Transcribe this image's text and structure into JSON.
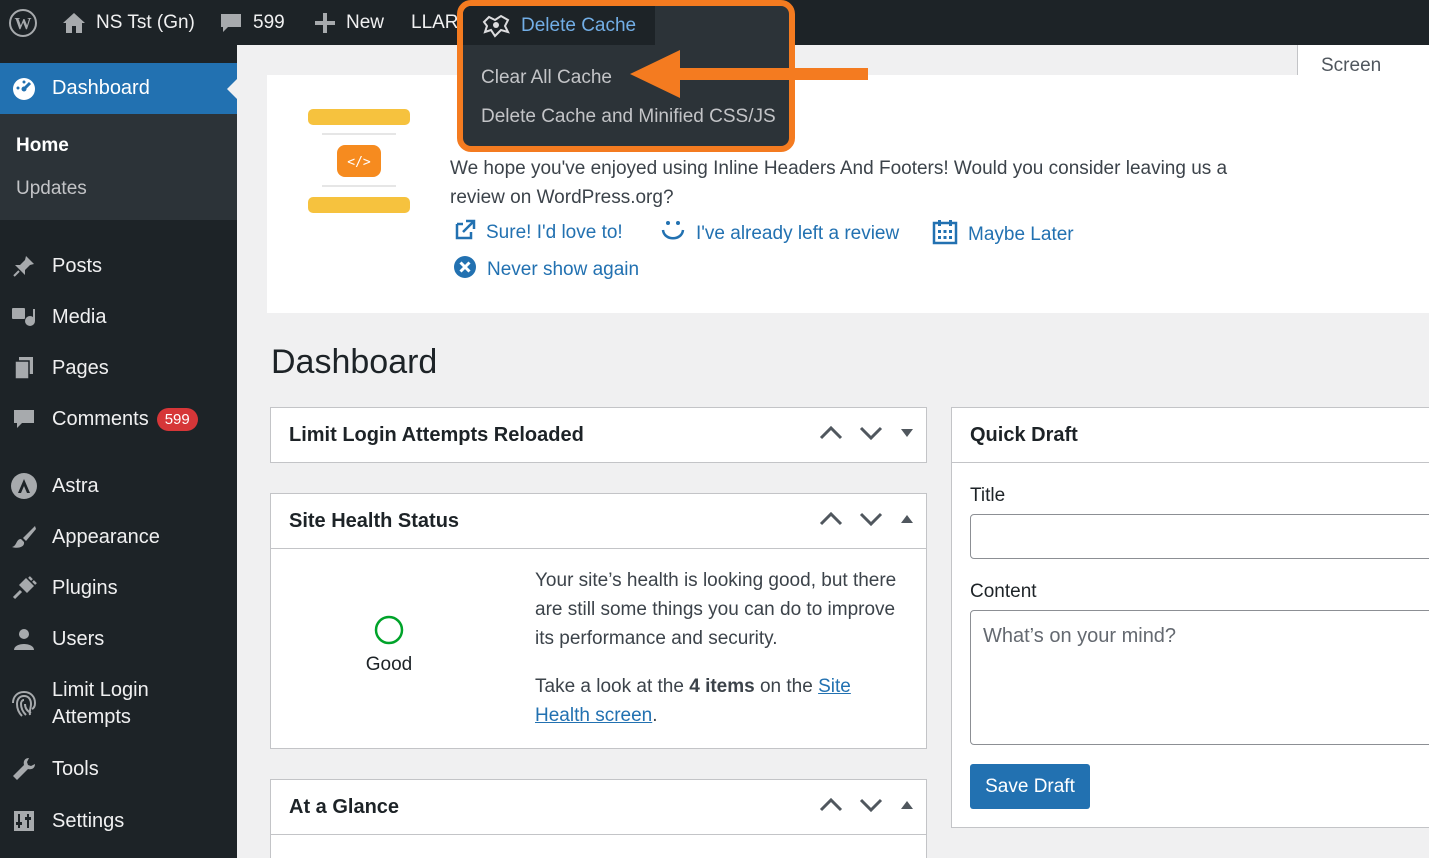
{
  "adminbar": {
    "site_name": "NS Tst (Gn)",
    "comments_count": "599",
    "new_label": "New",
    "llar_label": "LLAR"
  },
  "cache_menu": {
    "title": "Delete Cache",
    "items": [
      "Clear All Cache",
      "Delete Cache and Minified CSS/JS"
    ]
  },
  "screen_options": "Screen Options",
  "sidebar": {
    "dashboard": "Dashboard",
    "submenu": [
      "Home",
      "Updates"
    ],
    "items": [
      {
        "label": "Posts",
        "icon": "pin-icon"
      },
      {
        "label": "Media",
        "icon": "media-icon"
      },
      {
        "label": "Pages",
        "icon": "pages-icon"
      },
      {
        "label": "Comments",
        "icon": "comment-icon",
        "badge": "599"
      },
      {
        "label": "Astra",
        "icon": "astra-icon"
      },
      {
        "label": "Appearance",
        "icon": "brush-icon"
      },
      {
        "label": "Plugins",
        "icon": "plug-icon"
      },
      {
        "label": "Users",
        "icon": "user-icon"
      },
      {
        "label": "Limit Login Attempts",
        "icon": "fingerprint-icon"
      },
      {
        "label": "Tools",
        "icon": "wrench-icon"
      },
      {
        "label": "Settings",
        "icon": "settings-icon"
      }
    ]
  },
  "notice": {
    "text": "We hope you've enjoyed using Inline Headers And Footers! Would you consider leaving us a review on WordPress.org?",
    "links": {
      "sure": "Sure! I'd love to!",
      "already": "I've already left a review",
      "later": "Maybe Later",
      "never": "Never show again"
    }
  },
  "page_title": "Dashboard",
  "widgets": {
    "llar": "Limit Login Attempts Reloaded",
    "health": {
      "title": "Site Health Status",
      "status": "Good",
      "p1": "Your site’s health is looking good, but there are still some things you can do to improve its performance and security.",
      "p2_before": "Take a look at the ",
      "p2_count": "4 items",
      "p2_middle": " on the ",
      "p2_link": "Site Health screen",
      "p2_after": "."
    },
    "glance": "At a Glance",
    "quick_draft": {
      "title": "Quick Draft",
      "title_label": "Title",
      "content_label": "Content",
      "content_placeholder": "What’s on your mind?",
      "save": "Save Draft"
    }
  },
  "colors": {
    "admin_bg": "#1d2327",
    "accent": "#2271b1",
    "highlight": "#f47b20",
    "badge": "#d63638"
  }
}
